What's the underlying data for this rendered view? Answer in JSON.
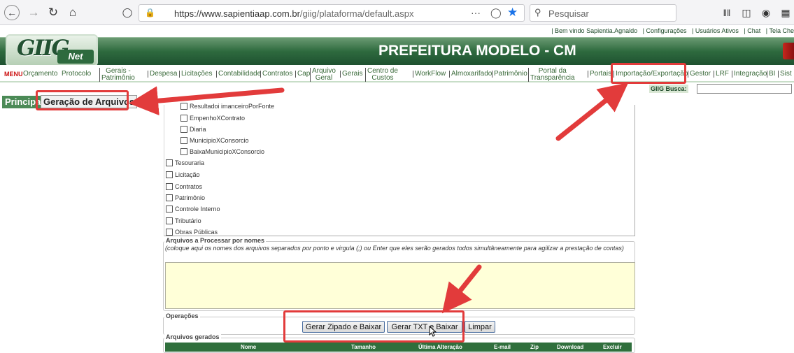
{
  "browser": {
    "url_host": "https://www.sapientiaap.com.br",
    "url_path": "/giig/plataforma/default.aspx",
    "search_placeholder": "Pesquisar",
    "more_label": "···"
  },
  "topbar": {
    "welcome": "| Bem vindo Sapientia.Agnaldo",
    "links": [
      "| Configurações",
      "| Usuários Ativos",
      "| Chat",
      "| Tela Che"
    ]
  },
  "header": {
    "logo_text": "GIIG",
    "logo_net": "Net",
    "title": "PREFEITURA MODELO - CM"
  },
  "menu": {
    "label": "MENU",
    "items": [
      {
        "label": "Orçamento"
      },
      {
        "label": "Protocolo"
      },
      {
        "label": "Gerais -",
        "label2": "Patrimônio"
      },
      {
        "label": "Despesa"
      },
      {
        "label": "Licitações"
      },
      {
        "label": "Contabilidade"
      },
      {
        "label": "Contratos"
      },
      {
        "label": "Cap"
      },
      {
        "label": "Arquivo",
        "label2": "Geral"
      },
      {
        "label": "Gerais"
      },
      {
        "label": "Centro de",
        "label2": "Custos"
      },
      {
        "label": "WorkFlow"
      },
      {
        "label": "Almoxarifado"
      },
      {
        "label": "Patrimônio"
      },
      {
        "label": "Portal da",
        "label2": "Transparência"
      },
      {
        "label": "Portais"
      },
      {
        "label": "Importação/Exportação"
      },
      {
        "label": "Gestor"
      },
      {
        "label": "LRF"
      },
      {
        "label": "Integração"
      },
      {
        "label": "BI"
      },
      {
        "label": "Sist"
      }
    ]
  },
  "search": {
    "label": "GIIG Busca:",
    "value": ""
  },
  "tabs": {
    "principal": "Principal",
    "current": "Geração de Arquivos"
  },
  "checklist": {
    "partial_top": "Resultadoi imanceiroPorFonte",
    "sub_items": [
      "EmpenhoXContrato",
      "Diaria",
      "MunicipioXConsorcio",
      "BaixaMunicipioXConsorcio"
    ],
    "items": [
      "Tesouraria",
      "Licitação",
      "Contratos",
      "Patrimônio",
      "Controle Interno",
      "Tributário",
      "Obras Públicas"
    ]
  },
  "arquivos_nomes": {
    "legend": "Arquivos a Processar por nomes",
    "description": "(coloque aqui os nomes dos arquivos separados por ponto e virgula (;) ou Enter que eles serão gerados todos simultâneamente para agilizar a prestação de contas)",
    "value": ""
  },
  "operacoes": {
    "legend": "Operações",
    "buttons": [
      "Gerar Zipado e Baixar",
      "Gerar TXT e Baixar",
      "Limpar"
    ]
  },
  "arquivos_gerados": {
    "legend": "Arquivos gerados",
    "columns": [
      "Nome",
      "Tamanho",
      "Última Alteração",
      "E-mail",
      "Zip",
      "Download",
      "Excluir"
    ]
  },
  "colors": {
    "brand_green": "#2e6a3e",
    "annotation_red": "#e23b3b",
    "textarea_bg": "#ffffd8"
  }
}
